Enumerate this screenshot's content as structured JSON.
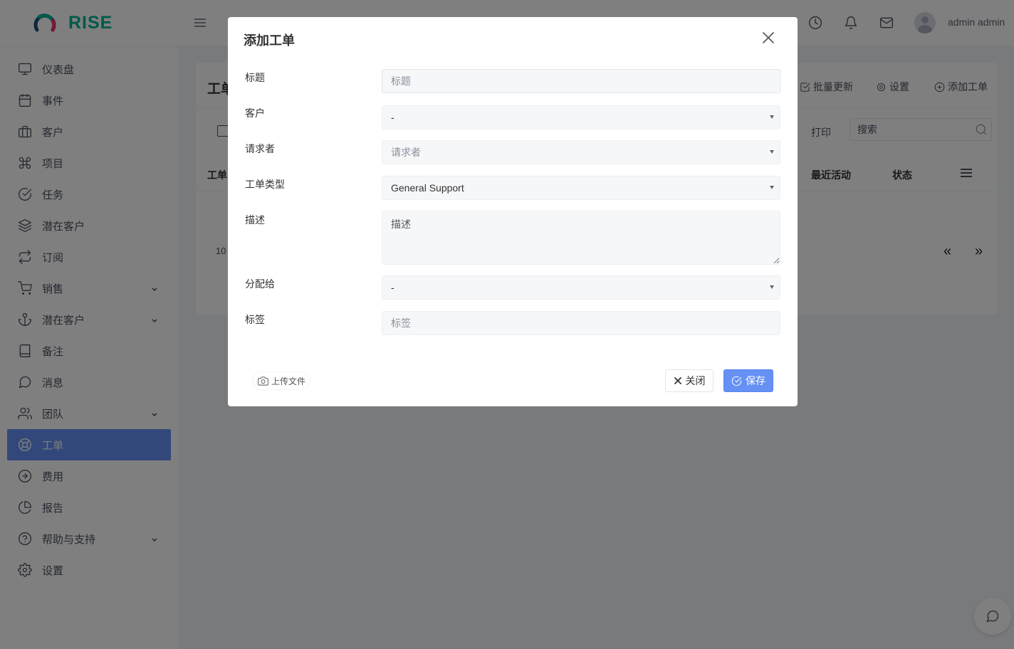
{
  "app": {
    "brand": "RISE",
    "brand_color": "#00b393",
    "accent": "#6690f4"
  },
  "sidebar": {
    "items": [
      {
        "label": "仪表盘",
        "icon": "monitor-icon"
      },
      {
        "label": "事件",
        "icon": "calendar-icon"
      },
      {
        "label": "客户",
        "icon": "briefcase-icon"
      },
      {
        "label": "项目",
        "icon": "command-icon"
      },
      {
        "label": "任务",
        "icon": "check-circle-icon"
      },
      {
        "label": "潜在客户",
        "icon": "layers-icon"
      },
      {
        "label": "订阅",
        "icon": "repeat-icon"
      },
      {
        "label": "销售",
        "icon": "cart-icon",
        "has_submenu": true
      },
      {
        "label": "潜在客户",
        "icon": "anchor-icon",
        "has_submenu": true
      },
      {
        "label": "备注",
        "icon": "book-icon"
      },
      {
        "label": "消息",
        "icon": "message-circle-icon"
      },
      {
        "label": "团队",
        "icon": "users-icon",
        "has_submenu": true
      },
      {
        "label": "工单",
        "icon": "life-buoy-icon",
        "active": true
      },
      {
        "label": "费用",
        "icon": "arrow-right-circle-icon"
      },
      {
        "label": "报告",
        "icon": "pie-chart-icon"
      },
      {
        "label": "帮助与支持",
        "icon": "help-circle-icon",
        "has_submenu": true
      },
      {
        "label": "设置",
        "icon": "settings-icon"
      }
    ]
  },
  "topbar": {
    "icons": [
      "menu-icon",
      "clock-icon",
      "bell-icon",
      "mail-icon"
    ],
    "user_name": "admin admin"
  },
  "page": {
    "title": "工单",
    "actions": {
      "batch_update": "批量更新",
      "settings": "设置",
      "add_ticket": "添加工单"
    },
    "print": "打印",
    "search_placeholder": "搜索",
    "columns": {
      "first": "工单",
      "last_activity": "最近活动",
      "status": "状态"
    },
    "page_size": "10",
    "pager": {
      "prev": "«",
      "next": "»"
    }
  },
  "modal": {
    "title": "添加工单",
    "fields": {
      "title": {
        "label": "标题",
        "placeholder": "标题"
      },
      "client": {
        "label": "客户",
        "value": "-"
      },
      "requester": {
        "label": "请求者",
        "placeholder": "请求者"
      },
      "ticket_type": {
        "label": "工单类型",
        "value": "General Support"
      },
      "description": {
        "label": "描述",
        "placeholder": "描述"
      },
      "assign_to": {
        "label": "分配给",
        "value": "-"
      },
      "labels": {
        "label": "标签",
        "placeholder": "标签"
      }
    },
    "upload_label": "上传文件",
    "close_label": "关闭",
    "save_label": "保存"
  }
}
